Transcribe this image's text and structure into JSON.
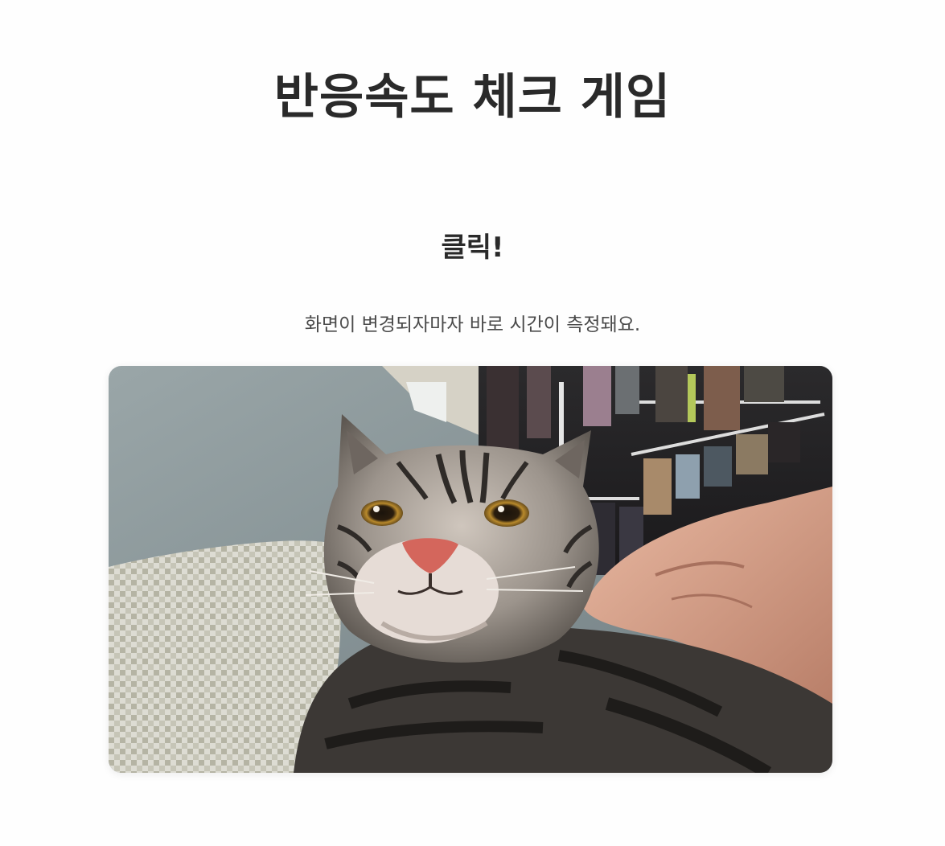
{
  "header": {
    "title": "반응속도 체크 게임"
  },
  "game": {
    "prompt": "클릭!",
    "instruction": "화면이 변경되자마자 바로 시간이 측정돼요.",
    "image_subject": "cat-photo"
  },
  "colors": {
    "background": "#fefefe",
    "title_text": "#2a2a2a",
    "instruction_text": "#4a4a4a"
  }
}
